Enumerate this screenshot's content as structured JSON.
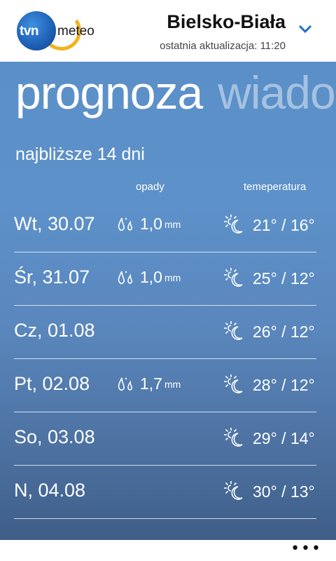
{
  "header": {
    "logo": {
      "tvn": "tvn",
      "meteo": "meteo"
    },
    "city": "Bielsko-Biała",
    "update_label": "ostatnia aktualizacja: 11:20"
  },
  "pivot": {
    "active": "prognoza",
    "next": "wiadom"
  },
  "forecast": {
    "title": "najbliższe 14 dni",
    "col_precip": "opady",
    "col_temp": "temeperatura",
    "days": [
      {
        "day": "Wt, 30.07",
        "precip": "1,0",
        "unit": "mm",
        "temp": "21° / 16°",
        "icon": "sun-moon-icon"
      },
      {
        "day": "Śr, 31.07",
        "precip": "1,0",
        "unit": "mm",
        "temp": "25° / 12°",
        "icon": "sun-moon-icon"
      },
      {
        "day": "Cz, 01.08",
        "precip": "",
        "unit": "",
        "temp": "26° / 12°",
        "icon": "sun-moon-icon"
      },
      {
        "day": "Pt, 02.08",
        "precip": "1,7",
        "unit": "mm",
        "temp": "28° / 12°",
        "icon": "sun-moon-icon"
      },
      {
        "day": "So, 03.08",
        "precip": "",
        "unit": "",
        "temp": "29° / 14°",
        "icon": "sun-moon-icon"
      },
      {
        "day": "N, 04.08",
        "precip": "",
        "unit": "",
        "temp": "30° / 13°",
        "icon": "sun-moon-icon"
      }
    ]
  },
  "appbar": {
    "more": "•••"
  },
  "colors": {
    "background_top": "#5b8fc8",
    "background_bottom": "#3f5e88",
    "accent": "#1d5fb5",
    "logo_swoosh": "#f2b21c"
  }
}
